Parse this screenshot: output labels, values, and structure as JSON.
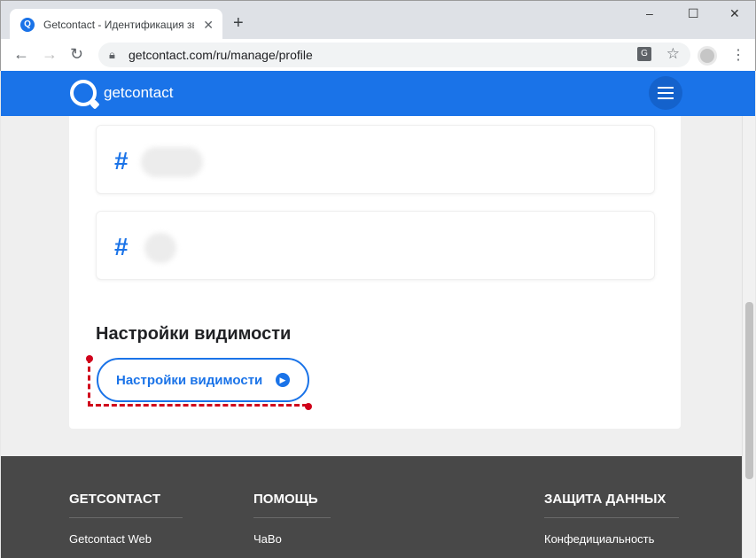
{
  "browser": {
    "tab_title": "Getcontact - Идентификация зв",
    "tab_close": "✕",
    "new_tab": "+",
    "window_controls": [
      "–",
      "☐",
      "✕"
    ],
    "url": "getcontact.com/ru/manage/profile"
  },
  "header": {
    "logo_text": "getcontact"
  },
  "visibility": {
    "heading": "Настройки видимости",
    "button_label": "Настройки видимости"
  },
  "tags": [
    {
      "symbol": "#"
    },
    {
      "symbol": "#"
    }
  ],
  "footer": {
    "col1": {
      "heading": "GETCONTACT",
      "link": "Getcontact Web"
    },
    "col2": {
      "heading": "ПОМОЩЬ",
      "link": "ЧаВо"
    },
    "col3": {
      "heading": "ЗАЩИТА ДАННЫХ",
      "link": "Конфедициальность"
    }
  },
  "colors": {
    "brand_blue": "#1a73e8",
    "highlight_red": "#d0021b",
    "footer_bg": "#484848"
  }
}
